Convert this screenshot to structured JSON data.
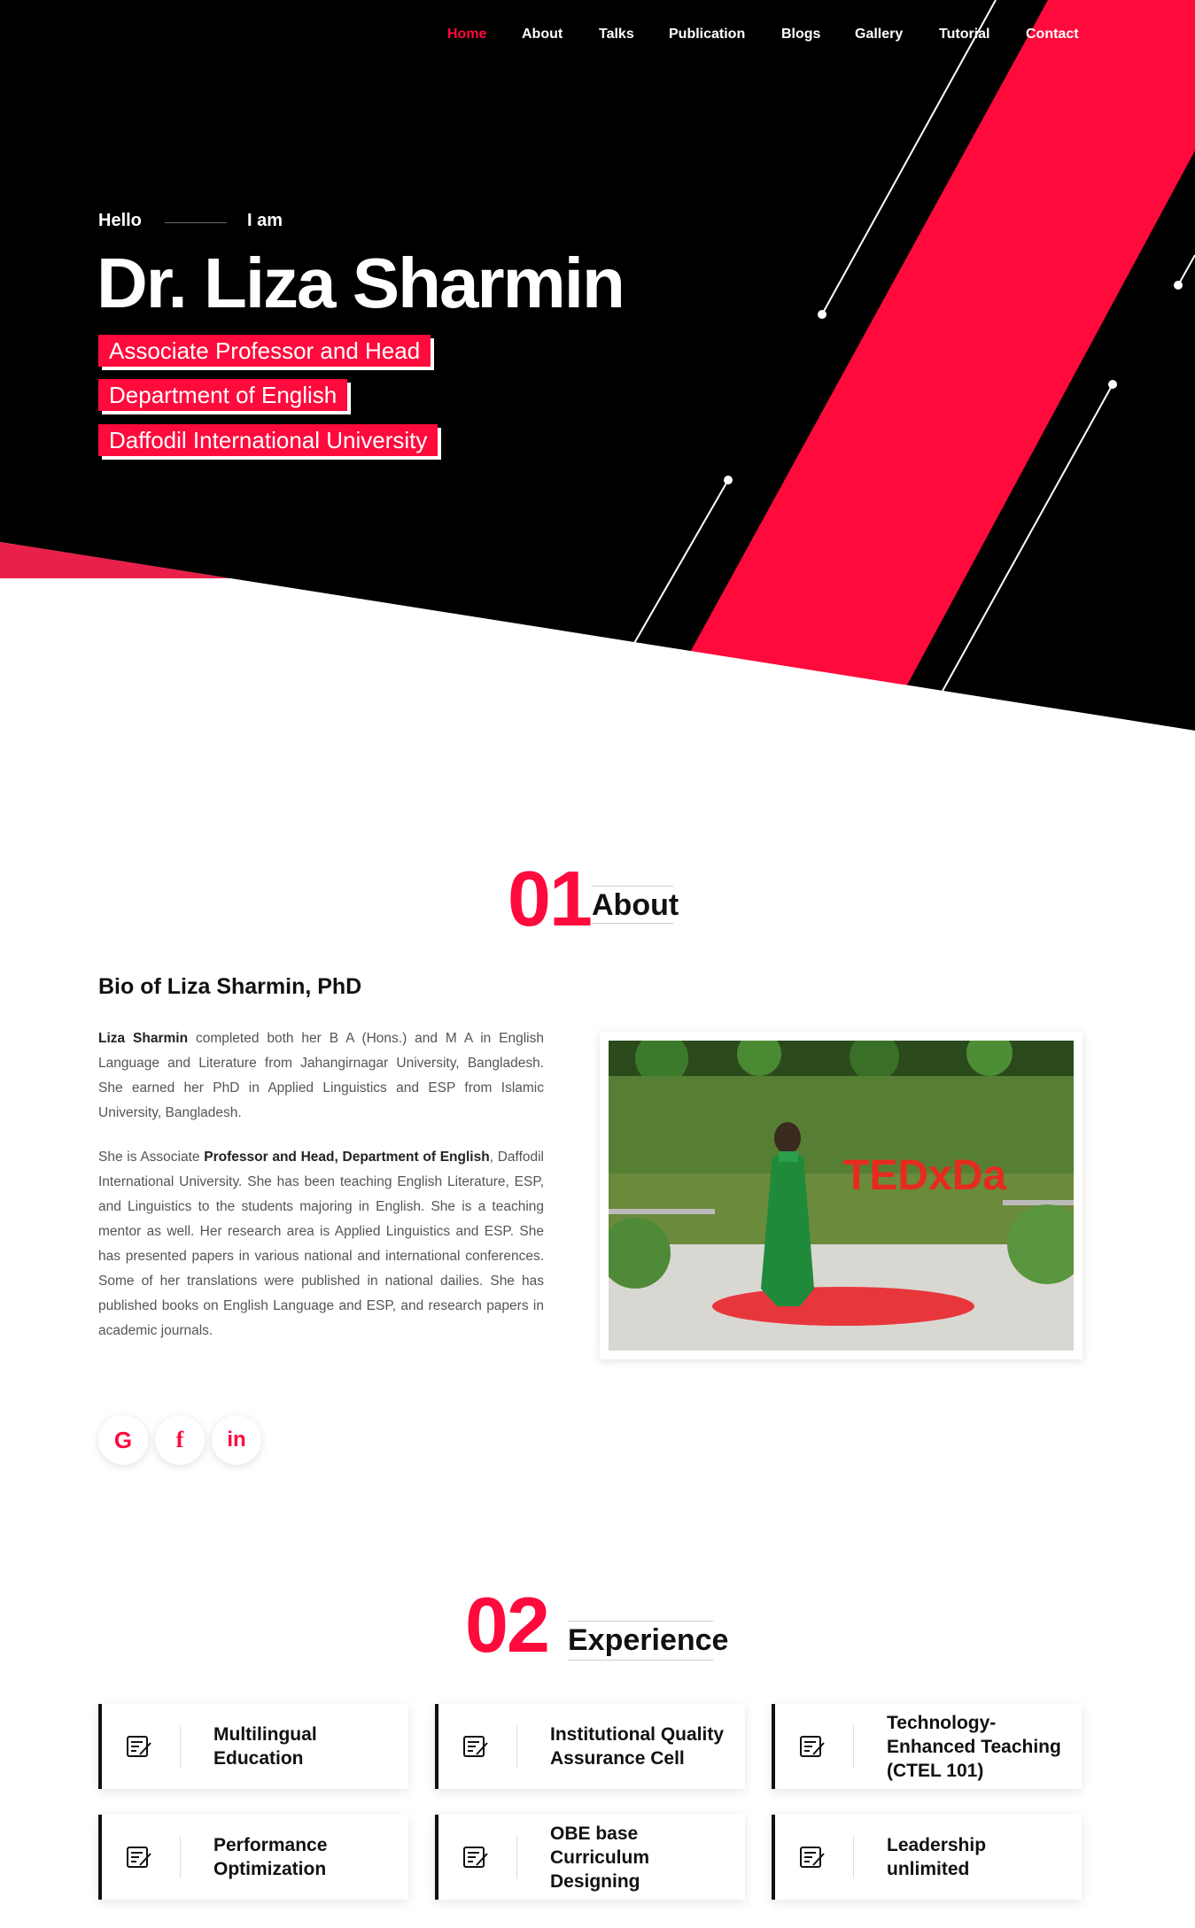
{
  "nav": {
    "items": [
      {
        "label": "Home",
        "active": true
      },
      {
        "label": "About",
        "active": false
      },
      {
        "label": "Talks",
        "active": false
      },
      {
        "label": "Publication",
        "active": false
      },
      {
        "label": "Blogs",
        "active": false
      },
      {
        "label": "Gallery",
        "active": false
      },
      {
        "label": "Tutorial",
        "active": false
      },
      {
        "label": "Contact",
        "active": false
      }
    ]
  },
  "hero": {
    "hello": "Hello",
    "iam": "I am",
    "name": "Dr. Liza Sharmin",
    "tags": [
      "Associate Professor and Head",
      "Department of English",
      "Daffodil International University"
    ]
  },
  "about": {
    "number": "01",
    "title": "About",
    "bio_title": "Bio of Liza Sharmin, PhD",
    "p1_bold": "Liza Sharmin",
    "p1_rest": " completed both her B A (Hons.) and M A in English Language and Literature from Jahangirnagar University, Bangladesh. She earned her PhD in Applied Linguistics and ESP from Islamic University, Bangladesh.",
    "p2_start": "She is Associate ",
    "p2_bold": "Professor and Head, Department of English",
    "p2_rest": ", Daffodil International University. She has been teaching English Literature, ESP, and Linguistics to the students majoring in English. She is a teaching mentor as well. Her research area is Applied Linguistics and ESP. She has presented papers in various national and international conferences. Some of her translations were published in national dailies. She has published books on English Language and ESP, and research papers in academic journals.",
    "photo_sign": "TEDxDa",
    "socials": [
      {
        "icon": "google-icon",
        "glyph": "G"
      },
      {
        "icon": "facebook-icon",
        "glyph": "f"
      },
      {
        "icon": "linkedin-icon",
        "glyph": "in"
      }
    ]
  },
  "experience": {
    "number": "02",
    "title": "Experience",
    "items": [
      "Multilingual Education",
      "Institutional Quality Assurance Cell",
      "Technology-Enhanced Teaching (CTEL 101)",
      "Performance Optimization",
      "OBE base Curriculum Designing",
      "Leadership unlimited"
    ]
  },
  "colors": {
    "accent": "#ff0a3c",
    "dark": "#000000",
    "text": "#555555"
  }
}
